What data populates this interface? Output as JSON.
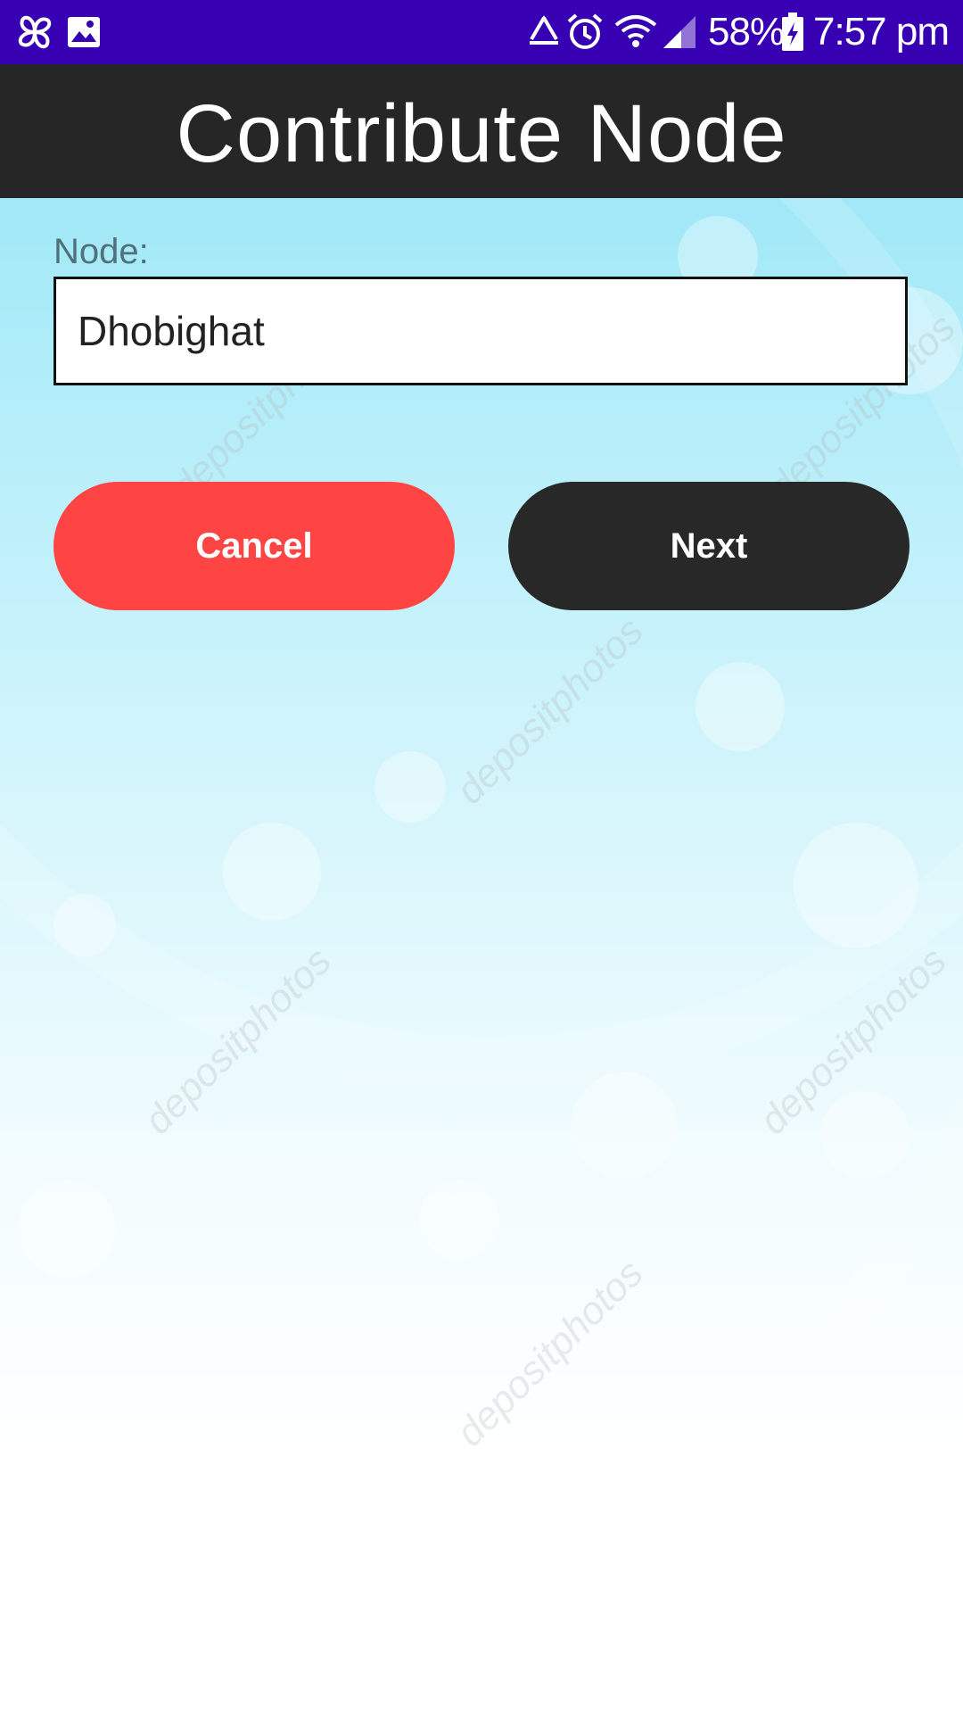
{
  "status_bar": {
    "battery": "58%",
    "time": "7:57 pm",
    "icons": [
      "pinwheel-icon",
      "image-icon",
      "recycle-icon",
      "alarm-icon",
      "wifi-icon",
      "signal-icon",
      "battery-charging-icon"
    ]
  },
  "app_bar": {
    "title": "Contribute Node"
  },
  "form": {
    "node_label": "Node:",
    "node_value": "Dhobighat"
  },
  "buttons": {
    "cancel_label": "Cancel",
    "next_label": "Next"
  },
  "colors": {
    "status_bar": "#3700b3",
    "app_bar": "#262626",
    "cancel": "#ff4444",
    "next": "#282828"
  },
  "watermark": "depositphotos"
}
